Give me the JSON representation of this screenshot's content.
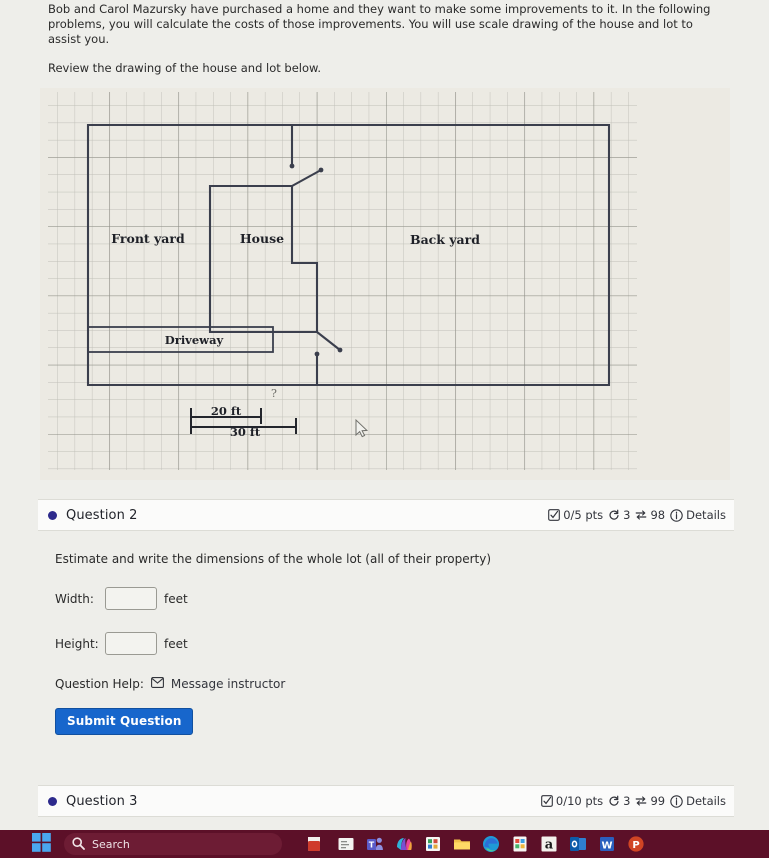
{
  "intro": {
    "paragraph": "Bob and Carol Mazursky have purchased a home and they want to make some improvements to it. In the following problems, you will calculate the costs of those improvements. You will use scale drawing of the house and lot to assist you.",
    "review_line": "Review the drawing of the house and lot below."
  },
  "diagram": {
    "labels": {
      "front_yard": "Front yard",
      "house": "House",
      "back_yard": "Back yard",
      "driveway": "Driveway"
    },
    "scale": {
      "short_label": "20 ft",
      "long_label": "30 ft"
    },
    "stray_mark": "?"
  },
  "question2": {
    "title": "Question 2",
    "points": "0/5 pts",
    "attempts": "3",
    "version": "98",
    "details": "Details",
    "prompt": "Estimate and write the dimensions of the whole lot (all of their property)",
    "width_label": "Width:",
    "width_value": "",
    "width_unit": "feet",
    "height_label": "Height:",
    "height_value": "",
    "height_unit": "feet",
    "help_label": "Question Help:",
    "message_instructor": "Message instructor",
    "submit_label": "Submit Question"
  },
  "question3": {
    "title": "Question 3",
    "points": "0/10 pts",
    "attempts": "3",
    "version": "99",
    "details": "Details"
  },
  "taskbar": {
    "search_placeholder": "Search",
    "apps": [
      "windows-start-icon",
      "search-icon",
      "sticky-notes-icon",
      "file-explorer-document-icon",
      "microsoft-teams-icon",
      "copilot-icon",
      "calculator-icon",
      "folder-icon",
      "microsoft-edge-icon",
      "app-colorful-icon",
      "amazon-icon",
      "outlook-icon",
      "word-icon",
      "powerpoint-icon"
    ]
  },
  "colors": {
    "accent_blue": "#1766cc",
    "question_dot": "#2d2a8c",
    "taskbar": "#5c1028",
    "page_bg": "#eeeeea"
  }
}
